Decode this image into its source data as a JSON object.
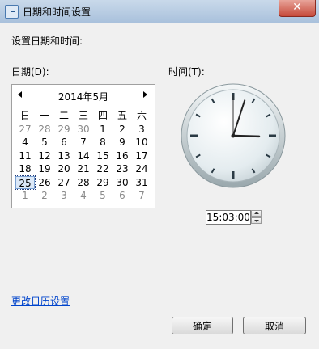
{
  "window": {
    "title": "日期和时间设置",
    "close_symbol": "✕"
  },
  "prompt": "设置日期和时间:",
  "date_label": "日期(D):",
  "time_label": "时间(T):",
  "calendar": {
    "title": "2014年5月",
    "days_of_week": [
      "日",
      "一",
      "二",
      "三",
      "四",
      "五",
      "六"
    ],
    "weeks": [
      [
        {
          "d": "27",
          "other": true
        },
        {
          "d": "28",
          "other": true
        },
        {
          "d": "29",
          "other": true
        },
        {
          "d": "30",
          "other": true
        },
        {
          "d": "1"
        },
        {
          "d": "2"
        },
        {
          "d": "3"
        }
      ],
      [
        {
          "d": "4"
        },
        {
          "d": "5"
        },
        {
          "d": "6"
        },
        {
          "d": "7"
        },
        {
          "d": "8"
        },
        {
          "d": "9"
        },
        {
          "d": "10"
        }
      ],
      [
        {
          "d": "11"
        },
        {
          "d": "12"
        },
        {
          "d": "13"
        },
        {
          "d": "14"
        },
        {
          "d": "15"
        },
        {
          "d": "16"
        },
        {
          "d": "17"
        }
      ],
      [
        {
          "d": "18"
        },
        {
          "d": "19"
        },
        {
          "d": "20"
        },
        {
          "d": "21"
        },
        {
          "d": "22"
        },
        {
          "d": "23"
        },
        {
          "d": "24"
        }
      ],
      [
        {
          "d": "25",
          "selected": true
        },
        {
          "d": "26"
        },
        {
          "d": "27"
        },
        {
          "d": "28"
        },
        {
          "d": "29"
        },
        {
          "d": "30"
        },
        {
          "d": "31"
        }
      ],
      [
        {
          "d": "1",
          "other": true
        },
        {
          "d": "2",
          "other": true
        },
        {
          "d": "3",
          "other": true
        },
        {
          "d": "4",
          "other": true
        },
        {
          "d": "5",
          "other": true
        },
        {
          "d": "6",
          "other": true
        },
        {
          "d": "7",
          "other": true
        }
      ]
    ]
  },
  "clock": {
    "hour": 15,
    "minute": 3,
    "second": 0
  },
  "time_value": "15:03:00",
  "change_calendar_link": "更改日历设置",
  "buttons": {
    "ok": "确定",
    "cancel": "取消"
  },
  "colors": {
    "link": "#0044cc",
    "selected_bg": "#dbe8f8"
  }
}
